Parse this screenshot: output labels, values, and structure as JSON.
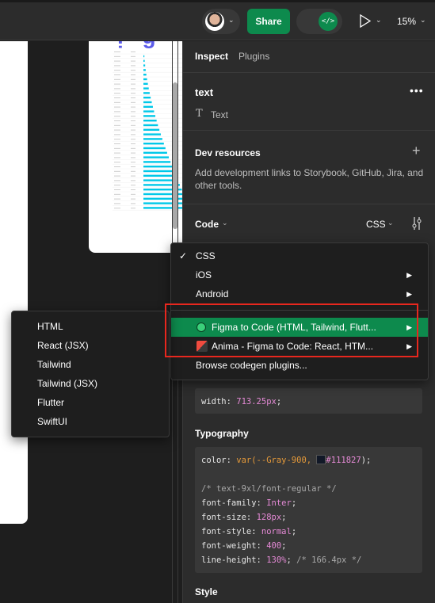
{
  "toolbar": {
    "share_label": "Share",
    "dev_mode_icon": "code-icon",
    "zoom": "15%"
  },
  "panel": {
    "tabs": [
      {
        "label": "Inspect",
        "active": true
      },
      {
        "label": "Plugins",
        "active": false
      }
    ],
    "layer": {
      "name": "text",
      "type": "Text"
    },
    "dev_resources": {
      "title": "Dev resources",
      "description": "Add development links to Storybook, GitHub, Jira, and other tools."
    },
    "code": {
      "title": "Code",
      "language": "CSS"
    },
    "layout_code": {
      "prop": "width",
      "value": "713.25px"
    },
    "typography": {
      "title": "Typography",
      "lines": {
        "color_prop": "color",
        "color_fn": "var(--Gray-900, ",
        "color_hex": "#111827",
        "color_end": ");",
        "comment": "/* text-9xl/font-regular */",
        "family_prop": "font-family",
        "family_val": "Inter",
        "size_prop": "font-size",
        "size_val": "128px",
        "style_prop": "font-style",
        "style_val": "normal",
        "weight_prop": "font-weight",
        "weight_val": "400",
        "lh_prop": "line-height",
        "lh_val": "130%",
        "lh_comment": "/* 166.4px */"
      }
    },
    "style_title": "Style"
  },
  "menu": {
    "items": [
      {
        "label": "CSS",
        "checked": true
      },
      {
        "label": "iOS",
        "submenu": true
      },
      {
        "label": "Android",
        "submenu": true
      },
      {
        "label": "Figma to Code (HTML, Tailwind, Flutt...",
        "submenu": true,
        "highlighted": true
      },
      {
        "label": "Anima - Figma to Code: React, HTM...",
        "submenu": true
      },
      {
        "label": "Browse codegen plugins..."
      }
    ]
  },
  "submenu": {
    "items": [
      "HTML",
      "React (JSX)",
      "Tailwind",
      "Tailwind (JSX)",
      "Flutter",
      "SwiftUI"
    ]
  },
  "colors": {
    "accent": "#0d8a4d",
    "highlight_box": "#e8271e",
    "swatch": "#111827",
    "bars": "#00c8e8"
  }
}
